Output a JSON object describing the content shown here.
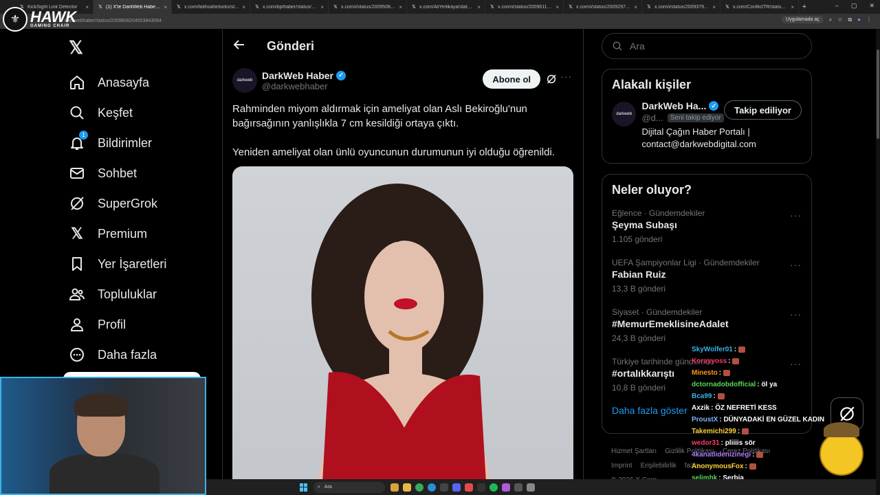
{
  "browser": {
    "tabs": [
      {
        "label": "KickSight Link Detector",
        "active": false
      },
      {
        "label": "(1) X'te DarkWeb Haber: \"Rah",
        "active": true
      },
      {
        "label": "x.com/fatihsahinturks/status/",
        "active": false
      },
      {
        "label": "x.com/bpthaber/status/20093",
        "active": false
      },
      {
        "label": "x.com/i/status/20095084683",
        "active": false
      },
      {
        "label": "x.com/AliYerlikaya/status/200",
        "active": false
      },
      {
        "label": "x.com/i/status/200961177985",
        "active": false
      },
      {
        "label": "x.com/i/status/200929725035",
        "active": false
      },
      {
        "label": "x.com/i/status/200937920597",
        "active": false
      },
      {
        "label": "x.com/ConflictTR/status/200",
        "active": false
      }
    ],
    "url": "darkwebhaber/status/2009606204553843064",
    "app_chip": "Uygulamada aç"
  },
  "overlay": {
    "brand": "HAWK",
    "brand_sub": "GAMING CHAIR"
  },
  "nav": {
    "items": [
      {
        "label": "Anasayfa",
        "icon": "home-icon"
      },
      {
        "label": "Keşfet",
        "icon": "search-icon"
      },
      {
        "label": "Bildirimler",
        "icon": "bell-icon",
        "badge": "1"
      },
      {
        "label": "Sohbet",
        "icon": "mail-icon"
      },
      {
        "label": "SuperGrok",
        "icon": "grok-icon"
      },
      {
        "label": "Premium",
        "icon": "x-icon"
      },
      {
        "label": "Yer İşaretleri",
        "icon": "bookmark-icon"
      },
      {
        "label": "Topluluklar",
        "icon": "people-icon"
      },
      {
        "label": "Profil",
        "icon": "person-icon"
      },
      {
        "label": "Daha fazla",
        "icon": "more-icon"
      }
    ]
  },
  "post": {
    "header_title": "Gönderi",
    "author_name": "DarkWeb Haber",
    "author_handle": "@darkwebhaber",
    "avatar_text": "darkweb",
    "subscribe_label": "Abone ol",
    "paragraph1": "Rahminden miyom aldırmak için ameliyat olan Aslı Bekiroğlu'nun bağırsağının yanlışlıkla 7 cm kesildiği ortaya çıktı.",
    "paragraph2": "Yeniden ameliyat olan ünlü oyuncunun durumunun iyi olduğu öğrenildi."
  },
  "search": {
    "placeholder": "Ara"
  },
  "related": {
    "title": "Alakalı kişiler",
    "name": "DarkWeb Ha...",
    "handle": "@d...",
    "follows_you": "Seni takip ediyor",
    "follow_label": "Takip ediliyor",
    "bio": "Dijital Çağın Haber Portalı | contact@darkwebdigital.com"
  },
  "trends": {
    "title": "Neler oluyor?",
    "items": [
      {
        "category": "Eğlence · Gündemdekiler",
        "name": "Şeyma Subaşı",
        "count": "1.105 gönderi"
      },
      {
        "category": "UEFA Şampiyonlar Ligi · Gündemdekiler",
        "name": "Fabian Ruiz",
        "count": "13,3 B gönderi"
      },
      {
        "category": "Siyaset · Gündemdekiler",
        "name": "#MemurEmeklisineAdalet",
        "count": "24,3 B gönderi"
      },
      {
        "category": "Türkiye tarihinde gündemde",
        "name": "#ortalıkkarıştı",
        "count": "10,8 B gönderi"
      }
    ],
    "show_more": "Daha fazla göster"
  },
  "footer": {
    "line1a": "Hizmet Şartları",
    "line1b": "Gizlilik Politikası",
    "line1c": "Çerez Politikası",
    "line2a": "Imprint",
    "line2b": "Erişilebilirlik",
    "line2c": "fazla ...",
    "copyright": "© 2026 X Corp."
  },
  "chat": [
    {
      "user": "SkyWolfer01",
      "color": "#3ab3e6",
      "text": "",
      "emote": true
    },
    {
      "user": "Korayyoss",
      "color": "#ff3b6b",
      "text": "",
      "emote": true
    },
    {
      "user": "Minesto",
      "color": "#ff9a1f",
      "text": "",
      "emote": true
    },
    {
      "user": "dctornadobdofficial",
      "color": "#5ad65a",
      "text": "öl ya",
      "emote": false
    },
    {
      "user": "Bca99",
      "color": "#3ab3e6",
      "text": "",
      "emote": true
    },
    {
      "user": "Axzik",
      "color": "#ffffff",
      "text": "ÖZ NEFRETİ KESS",
      "emote": false
    },
    {
      "user": "ProustX",
      "color": "#7ab8ff",
      "text": "DÜNYADAKİ EN GÜZEL KADIN",
      "emote": false
    },
    {
      "user": "Takemichi299",
      "color": "#ffd23a",
      "text": "",
      "emote": true
    },
    {
      "user": "wedor31",
      "color": "#ff3b6b",
      "text": "pliiiis sör",
      "emote": false
    },
    {
      "user": "4kanatlidenizinegi",
      "color": "#b07aff",
      "text": "",
      "emote": true
    },
    {
      "user": "AnonymousFox",
      "color": "#ffd23a",
      "text": "",
      "emote": true
    },
    {
      "user": "selimhk",
      "color": "#5ad65a",
      "text": "Serbia",
      "emote": false
    }
  ],
  "taskbar": {
    "search_label": "Ara"
  },
  "colors": {
    "accent": "#1d9bf0",
    "border": "#2f3336",
    "muted": "#71767b"
  }
}
